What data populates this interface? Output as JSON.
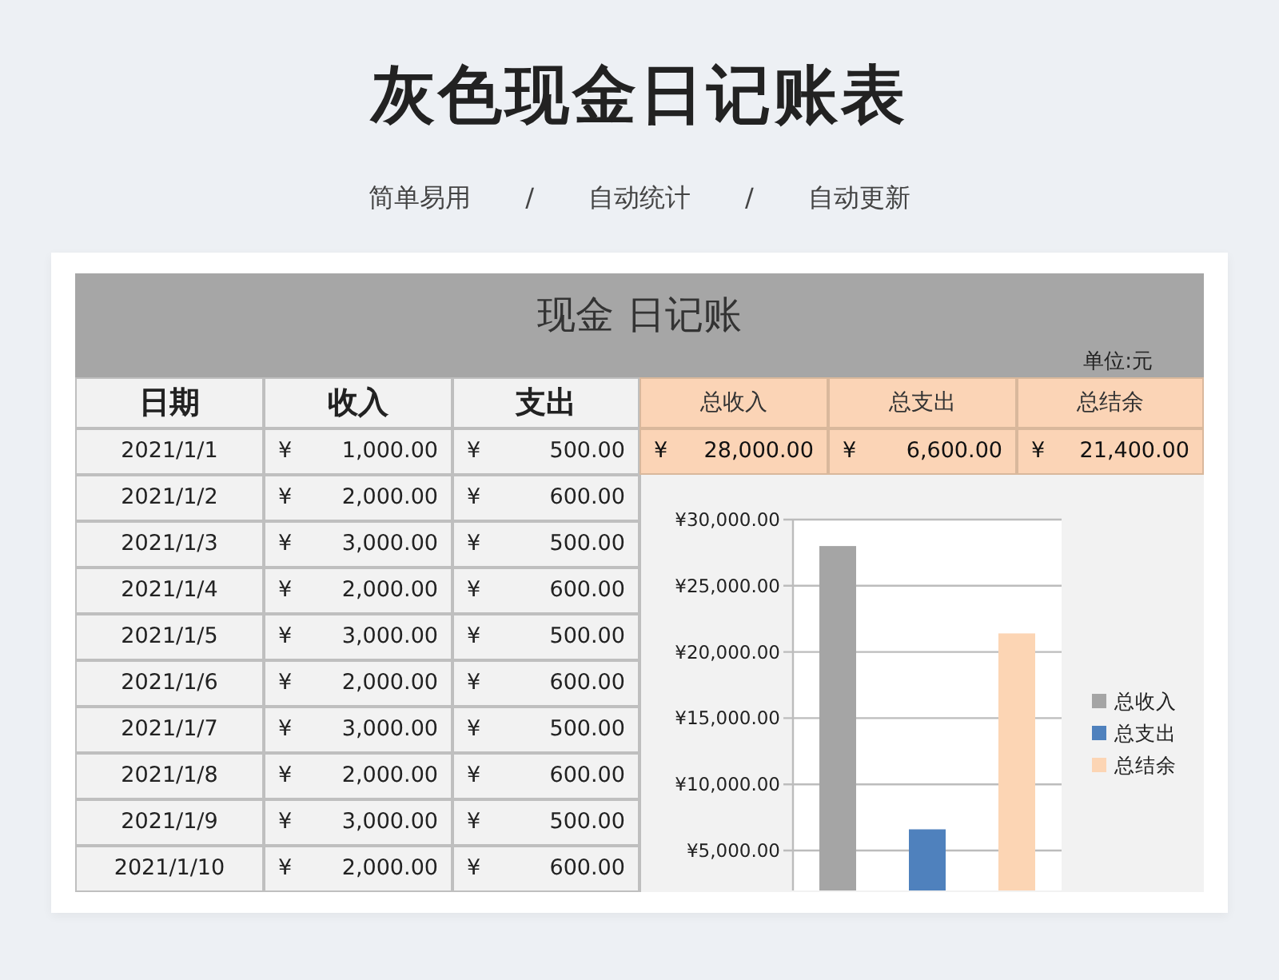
{
  "page": {
    "title": "灰色现金日记账表",
    "tags": [
      "简单易用",
      "自动统计",
      "自动更新"
    ],
    "separator": "/"
  },
  "sheet": {
    "title_parts": [
      "现金",
      "日记账"
    ],
    "unit": "单位:元",
    "columns": [
      "日期",
      "收入",
      "支出"
    ],
    "summary": {
      "columns": [
        "总收入",
        "总支出",
        "总结余"
      ],
      "values": [
        {
          "currency": "¥",
          "amount": "28,000.00"
        },
        {
          "currency": "¥",
          "amount": "6,600.00"
        },
        {
          "currency": "¥",
          "amount": "21,400.00"
        }
      ]
    },
    "rows": [
      {
        "date": "2021/1/1",
        "income_currency": "¥",
        "income": "1,000.00",
        "expense_currency": "¥",
        "expense": "500.00"
      },
      {
        "date": "2021/1/2",
        "income_currency": "¥",
        "income": "2,000.00",
        "expense_currency": "¥",
        "expense": "600.00"
      },
      {
        "date": "2021/1/3",
        "income_currency": "¥",
        "income": "3,000.00",
        "expense_currency": "¥",
        "expense": "500.00"
      },
      {
        "date": "2021/1/4",
        "income_currency": "¥",
        "income": "2,000.00",
        "expense_currency": "¥",
        "expense": "600.00"
      },
      {
        "date": "2021/1/5",
        "income_currency": "¥",
        "income": "3,000.00",
        "expense_currency": "¥",
        "expense": "500.00"
      },
      {
        "date": "2021/1/6",
        "income_currency": "¥",
        "income": "2,000.00",
        "expense_currency": "¥",
        "expense": "600.00"
      },
      {
        "date": "2021/1/7",
        "income_currency": "¥",
        "income": "3,000.00",
        "expense_currency": "¥",
        "expense": "500.00"
      },
      {
        "date": "2021/1/8",
        "income_currency": "¥",
        "income": "2,000.00",
        "expense_currency": "¥",
        "expense": "600.00"
      },
      {
        "date": "2021/1/9",
        "income_currency": "¥",
        "income": "3,000.00",
        "expense_currency": "¥",
        "expense": "500.00"
      },
      {
        "date": "2021/1/10",
        "income_currency": "¥",
        "income": "2,000.00",
        "expense_currency": "¥",
        "expense": "600.00"
      }
    ],
    "chart_data": {
      "type": "bar",
      "stacked": false,
      "grid": "y",
      "legend": "right",
      "series": [
        {
          "name": "总收入",
          "color": "#a5a5a5",
          "values": [
            28000
          ]
        },
        {
          "name": "总支出",
          "color": "#4f81bd",
          "values": [
            6600
          ]
        },
        {
          "name": "总结余",
          "color": "#fcd5b4",
          "values": [
            21400
          ]
        }
      ],
      "ylim": [
        2000,
        30000
      ],
      "yticks": [
        {
          "value": 5000,
          "label": "¥5,000.00"
        },
        {
          "value": 10000,
          "label": "¥10,000.00"
        },
        {
          "value": 15000,
          "label": "¥15,000.00"
        },
        {
          "value": 20000,
          "label": "¥20,000.00"
        },
        {
          "value": 25000,
          "label": "¥25,000.00"
        },
        {
          "value": 30000,
          "label": "¥30,000.00"
        }
      ]
    }
  }
}
